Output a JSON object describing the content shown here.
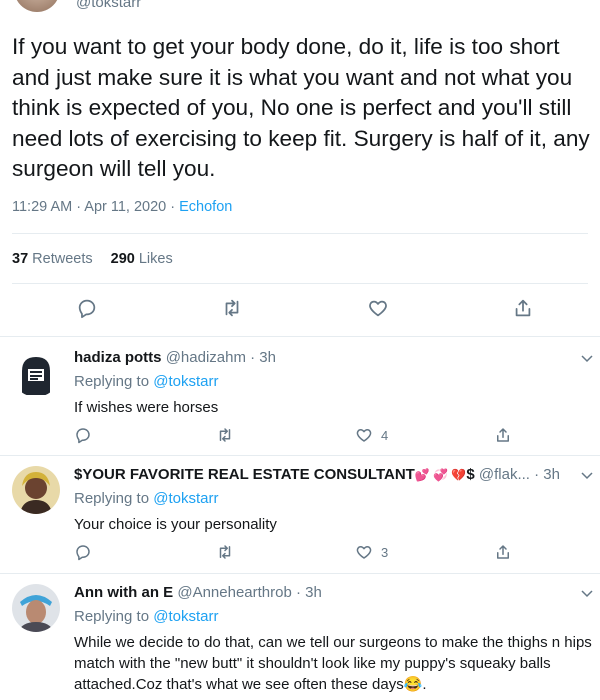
{
  "main_tweet": {
    "handle": "@tokstarr",
    "text": "If you want to get your body done, do it, life is too short and just make sure it is what you want and not what you think is expected of you, No one is perfect and you'll still need lots of exercising to keep fit. Surgery is half of it, any surgeon will tell you.",
    "time": "11:29 AM · Apr 11, 2020 · ",
    "source": "Echofon",
    "retweets_count": "37",
    "retweets_label": "Retweets",
    "likes_count": "290",
    "likes_label": "Likes"
  },
  "replies": [
    {
      "name": "hadiza potts",
      "handle": "@hadizahm",
      "time": "· 3h",
      "replying_prefix": "Replying to ",
      "replying_to": "@tokstarr",
      "text": "If wishes were horses",
      "like_count": "4"
    },
    {
      "name": "$YOUR FAVORITE REAL ESTATE CONSULTANT",
      "name_suffix": "$",
      "handle": "@flak...",
      "time": "· 3h",
      "replying_prefix": "Replying to ",
      "replying_to": "@tokstarr",
      "text": "Your choice is your personality",
      "like_count": "3"
    },
    {
      "name": "Ann with an E",
      "handle": "@Annehearthrob",
      "time": "· 3h",
      "replying_prefix": "Replying to ",
      "replying_to": "@tokstarr",
      "text": "While we decide to do that, can we tell our surgeons to make the thighs n hips match with the \"new butt\" it shouldn't look like my puppy's  squeaky balls attached.Coz that's what we see often these days😂."
    }
  ],
  "icons": {
    "reply": "reply-icon",
    "retweet": "retweet-icon",
    "like": "heart-icon",
    "share": "share-icon",
    "caret": "chevron-down-icon"
  },
  "colors": {
    "link": "#1da1f2",
    "secondary": "#657786",
    "text": "#14171a",
    "divider": "#e6ecf0"
  }
}
